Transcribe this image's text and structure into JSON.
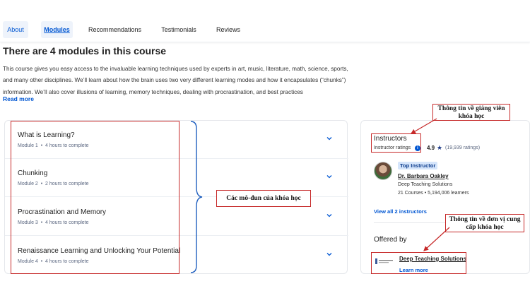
{
  "tabs": [
    {
      "label": "About"
    },
    {
      "label": "Modules"
    },
    {
      "label": "Recommendations"
    },
    {
      "label": "Testimonials"
    },
    {
      "label": "Reviews"
    }
  ],
  "main": {
    "title": "There are 4 modules in this course",
    "description": "This course gives you easy access to the invaluable learning techniques used by experts in art, music, literature, math, science, sports, and many other disciplines. We’ll learn about how the brain uses two very different learning modes and how it encapsulates (“chunks”) information. We’ll also cover illusions of learning, memory techniques, dealing with procrastination, and best practices",
    "read_more": "Read more"
  },
  "modules": [
    {
      "title": "What is Learning?",
      "module": "Module 1",
      "duration": "4 hours to complete"
    },
    {
      "title": "Chunking",
      "module": "Module 2",
      "duration": "2 hours to complete"
    },
    {
      "title": "Procrastination and Memory",
      "module": "Module 3",
      "duration": "4 hours to complete"
    },
    {
      "title": "Renaissance Learning and Unlocking Your Potential",
      "module": "Module 4",
      "duration": "4 hours to complete"
    }
  ],
  "meta_separator": "•",
  "instructors": {
    "heading": "Instructors",
    "ratings_label": "Instructor ratings",
    "rating": "4.9",
    "rating_count": "(19,939 ratings)",
    "badge": "Top Instructor",
    "name": "Dr. Barbara Oakley",
    "org": "Deep Teaching Solutions",
    "stats": "21 Courses  •  5,194,006 learners",
    "view_all": "View all 2 instructors"
  },
  "offered_by": {
    "heading": "Offered by",
    "org_name": "Deep Teaching Solutions",
    "learn_more": "Learn more"
  },
  "callouts": {
    "instructor_info": "Thông tin về giảng viên khóa học",
    "modules_info": "Các mô-đun của khóa học",
    "provider_info": "Thông tin về đơn vị cung cấp khóa học"
  },
  "colors": {
    "accent": "#0056d2",
    "annotation": "#c62828"
  }
}
